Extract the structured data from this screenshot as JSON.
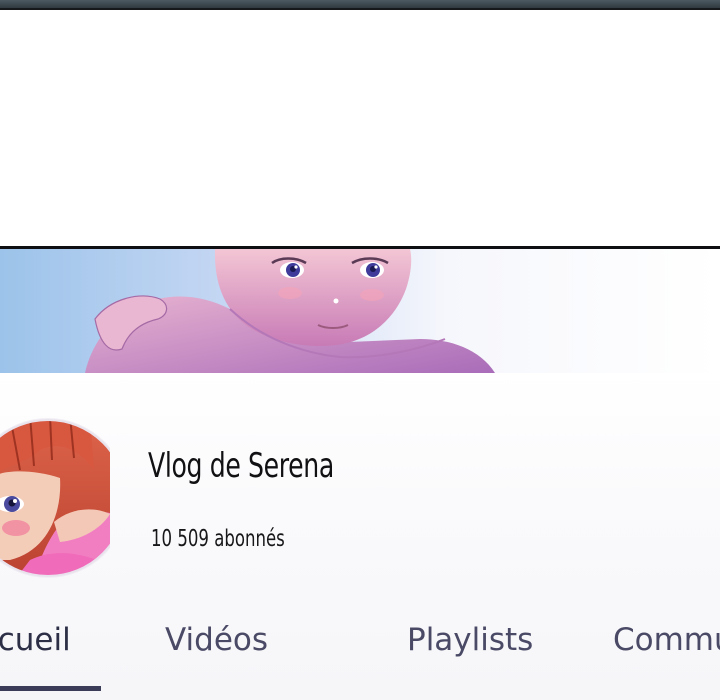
{
  "channel": {
    "name": "Vlog de Serena",
    "subscribers": "10 509 abonnés"
  },
  "tabs": [
    {
      "label": "Accueil",
      "active": true
    },
    {
      "label": "Vidéos",
      "active": false
    },
    {
      "label": "Playlists",
      "active": false
    },
    {
      "label": "Communauté",
      "active": false
    }
  ],
  "colors": {
    "tab_text": "#4a4a66",
    "tab_underline": "#3a3c58",
    "banner_sky": "#9cc3ea",
    "avatar_hair": "#d2523d"
  }
}
